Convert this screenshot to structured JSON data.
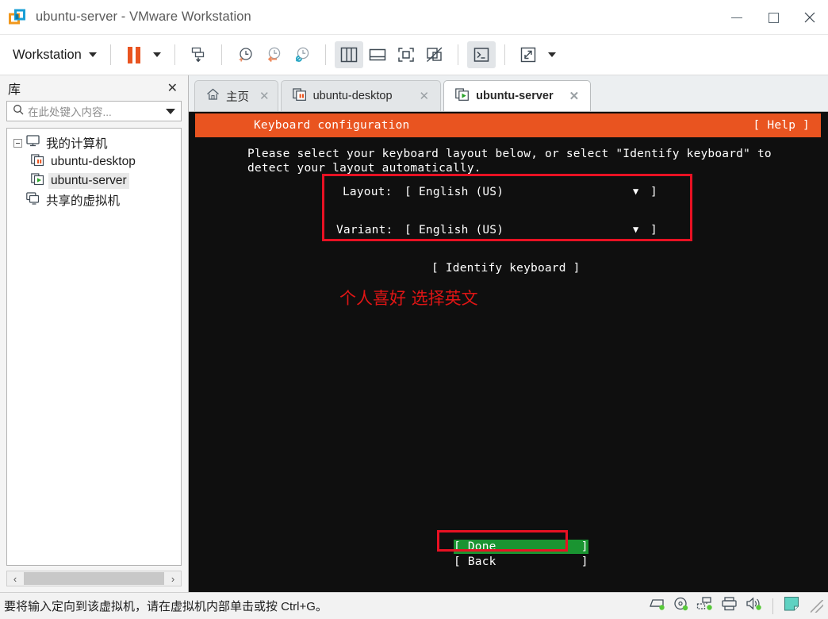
{
  "window": {
    "title": "ubuntu-server - VMware Workstation",
    "logo_icon": "vmware-logo-icon",
    "minimize_label": "minimize",
    "maximize_label": "maximize",
    "close_label": "close"
  },
  "toolbar": {
    "menu_label": "Workstation",
    "buttons": [
      {
        "name": "pause-button",
        "icon": "pause-icon"
      },
      {
        "name": "pause-dropdown",
        "icon": "chevron-down-icon"
      },
      {
        "name": "snapshot-manager-button",
        "icon": "snapshot-save-icon"
      },
      {
        "name": "take-snapshot-button",
        "icon": "clock-plus-icon"
      },
      {
        "name": "revert-snapshot-button",
        "icon": "clock-back-icon"
      },
      {
        "name": "manage-snapshots-button",
        "icon": "clock-wrench-icon"
      },
      {
        "name": "show-library-button",
        "icon": "sidebar-panel-icon"
      },
      {
        "name": "show-thumbnail-bar-button",
        "icon": "bottom-panel-icon"
      },
      {
        "name": "full-screen-button",
        "icon": "fullscreen-icon"
      },
      {
        "name": "unity-mode-button",
        "icon": "unity-mode-icon"
      },
      {
        "name": "console-view-button",
        "icon": "terminal-prompt-icon"
      },
      {
        "name": "stretch-view-button",
        "icon": "expand-arrows-icon"
      },
      {
        "name": "stretch-dropdown",
        "icon": "chevron-down-icon"
      }
    ]
  },
  "library": {
    "title": "库",
    "close_label": "✕",
    "search": {
      "placeholder": "在此处键入内容...",
      "value": "",
      "icon": "search-icon"
    },
    "tree": [
      {
        "label": "我的计算机",
        "icon": "computer-icon",
        "indent": 0,
        "expander": true,
        "selected": false
      },
      {
        "label": "ubuntu-desktop",
        "icon": "vm-suspended-icon",
        "indent": 1,
        "expander": false,
        "selected": false
      },
      {
        "label": "ubuntu-server",
        "icon": "vm-running-icon",
        "indent": 1,
        "expander": false,
        "selected": true
      },
      {
        "label": "共享的虚拟机",
        "icon": "shared-vms-icon",
        "indent": 0,
        "expander": false,
        "selected": false
      }
    ],
    "hscroll": {
      "left_arrow": "‹",
      "right_arrow": "›"
    }
  },
  "tabs": [
    {
      "label": "主页",
      "icon": "home-icon",
      "active": false,
      "close": "✕"
    },
    {
      "label": "ubuntu-desktop",
      "icon": "vm-suspended-icon",
      "active": false,
      "close": "✕"
    },
    {
      "label": "ubuntu-server",
      "icon": "vm-running-icon",
      "active": true,
      "close": "✕"
    }
  ],
  "terminal": {
    "header_title": "Keyboard configuration",
    "header_help": "[ Help ]",
    "intro_line1": "Please select your keyboard layout below, or select \"Identify keyboard\" to",
    "intro_line2": "detect your layout automatically.",
    "layout_label": "Layout:",
    "layout_open": "[",
    "layout_value": "English (US)",
    "layout_caret": "▼",
    "layout_close": "]",
    "variant_label": "Variant:",
    "variant_open": "[",
    "variant_value": "English (US)",
    "variant_caret": "▼",
    "variant_close": "]",
    "identify_button": "[ Identify keyboard ]",
    "annotation": "个人喜好 选择英文",
    "done_button": "[ Done            ]",
    "back_button": "[ Back            ]",
    "colors": {
      "header_bg": "#e95420",
      "screen_bg": "#0f0f0f",
      "highlight_bg": "#1a9431",
      "annotation": "#e01515",
      "callout_border": "#e81123"
    }
  },
  "statusbar": {
    "message": "要将输入定向到该虚拟机，请在虚拟机内部单击或按 Ctrl+G。",
    "icons": [
      {
        "name": "hard-disk-status-icon"
      },
      {
        "name": "cd-dvd-status-icon"
      },
      {
        "name": "network-adapter-status-icon"
      },
      {
        "name": "printer-status-icon"
      },
      {
        "name": "sound-card-status-icon"
      },
      {
        "name": "message-log-icon"
      }
    ],
    "grip": "resize-grip-icon"
  }
}
